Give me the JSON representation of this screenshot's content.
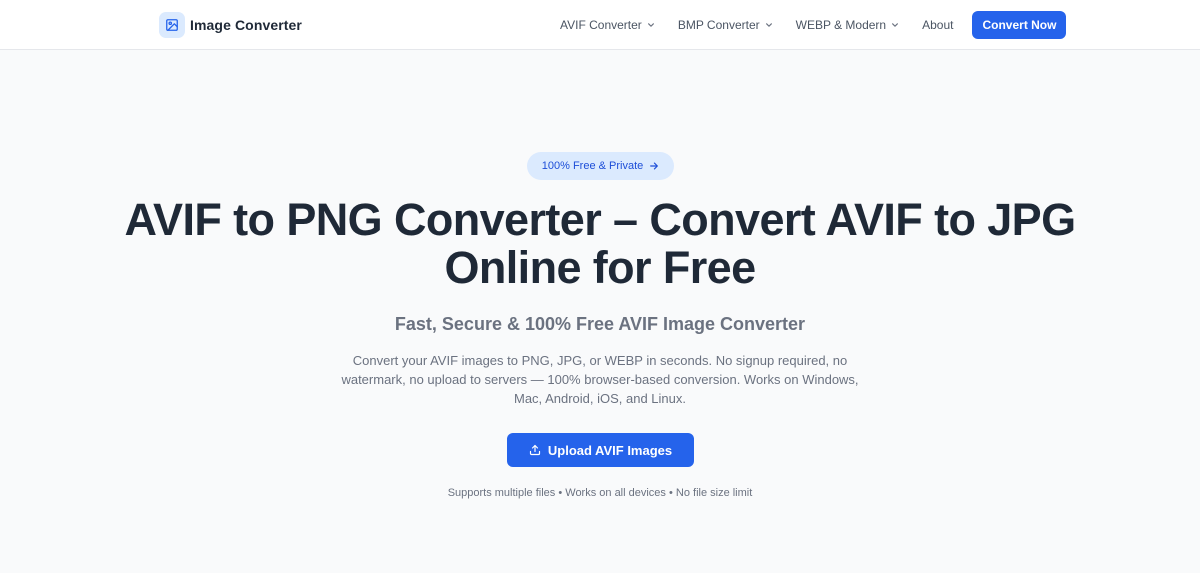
{
  "nav": {
    "brand": "Image Converter",
    "links": [
      {
        "label": "AVIF Converter",
        "dropdown": true
      },
      {
        "label": "BMP Converter",
        "dropdown": true
      },
      {
        "label": "WEBP & Modern",
        "dropdown": true
      },
      {
        "label": "About",
        "dropdown": false
      }
    ],
    "cta": "Convert Now"
  },
  "hero": {
    "badge": "100% Free & Private",
    "title": "AVIF to PNG Converter – Convert AVIF to JPG Online for Free",
    "subtitle": "Fast, Secure & 100% Free AVIF Image Converter",
    "description": "Convert your AVIF images to PNG, JPG, or WEBP in seconds. No signup required, no watermark, no upload to servers — 100% browser-based conversion. Works on Windows, Mac, Android, iOS, and Linux.",
    "upload_label": "Upload AVIF Images",
    "note": "Supports multiple files • Works on all devices • No file size limit"
  },
  "icons": {
    "brand": "image-icon",
    "dropdown": "chevron-down-icon",
    "badge": "arrow-right-icon",
    "upload": "upload-icon"
  },
  "colors": {
    "accent": "#2563eb",
    "badge_bg": "#dbeafe",
    "badge_text": "#1d4ed8",
    "heading": "#1f2937",
    "muted": "#6b7280",
    "background": "#f9fafb"
  }
}
